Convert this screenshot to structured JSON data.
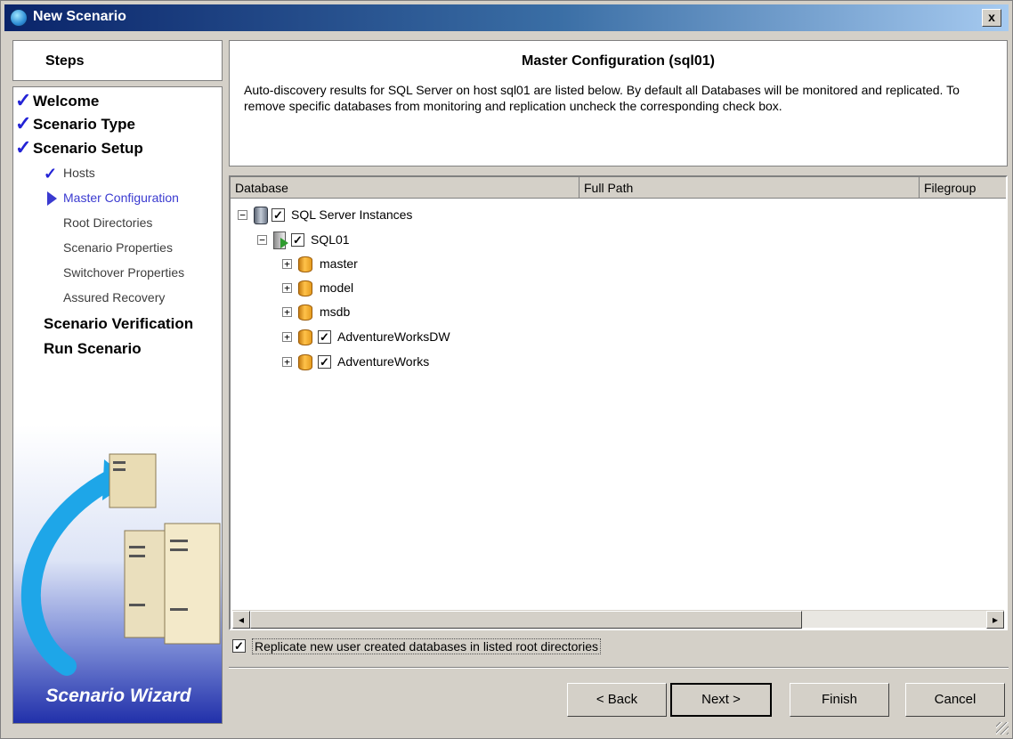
{
  "window": {
    "title": "New Scenario",
    "close_label": "x"
  },
  "steps": {
    "header": "Steps",
    "items": [
      {
        "label": "Welcome",
        "done": true
      },
      {
        "label": "Scenario Type",
        "done": true
      },
      {
        "label": "Scenario Setup",
        "done": true
      },
      {
        "label": "Hosts",
        "done": true
      },
      {
        "label": "Master Configuration",
        "current": true
      },
      {
        "label": "Root Directories"
      },
      {
        "label": "Scenario Properties"
      },
      {
        "label": "Switchover Properties"
      },
      {
        "label": "Assured Recovery"
      },
      {
        "label": "Scenario Verification"
      },
      {
        "label": "Run Scenario"
      }
    ],
    "wizard_title": "Scenario Wizard"
  },
  "header": {
    "title": "Master Configuration (sql01)",
    "description": "Auto-discovery results for SQL Server on host sql01 are listed below. By default all Databases will be monitored and replicated. To remove specific databases from monitoring and replication uncheck the corresponding check box."
  },
  "grid": {
    "columns": [
      "Database",
      "Full Path",
      "Filegroup"
    ],
    "tree": [
      {
        "label": "SQL Server Instances",
        "checked": true,
        "expander": "−"
      },
      {
        "label": "SQL01",
        "checked": true,
        "expander": "−"
      },
      {
        "label": "master",
        "checkbox": false,
        "expander": "+"
      },
      {
        "label": "model",
        "checkbox": false,
        "expander": "+"
      },
      {
        "label": "msdb",
        "checkbox": false,
        "expander": "+"
      },
      {
        "label": "AdventureWorksDW",
        "checked": true,
        "expander": "+"
      },
      {
        "label": "AdventureWorks",
        "checked": true,
        "expander": "+"
      }
    ],
    "scroll_left": "◂",
    "scroll_right": "▸"
  },
  "options": {
    "replicate_label": "Replicate new user created databases in listed root directories",
    "replicate_checked": true,
    "check_mark": "✓"
  },
  "buttons": {
    "back": "< Back",
    "next": "Next >",
    "finish": "Finish",
    "cancel": "Cancel"
  },
  "colors": {
    "accent": "#3a3ad0",
    "check": "#2323d6",
    "title_bar": "#0a246a"
  }
}
